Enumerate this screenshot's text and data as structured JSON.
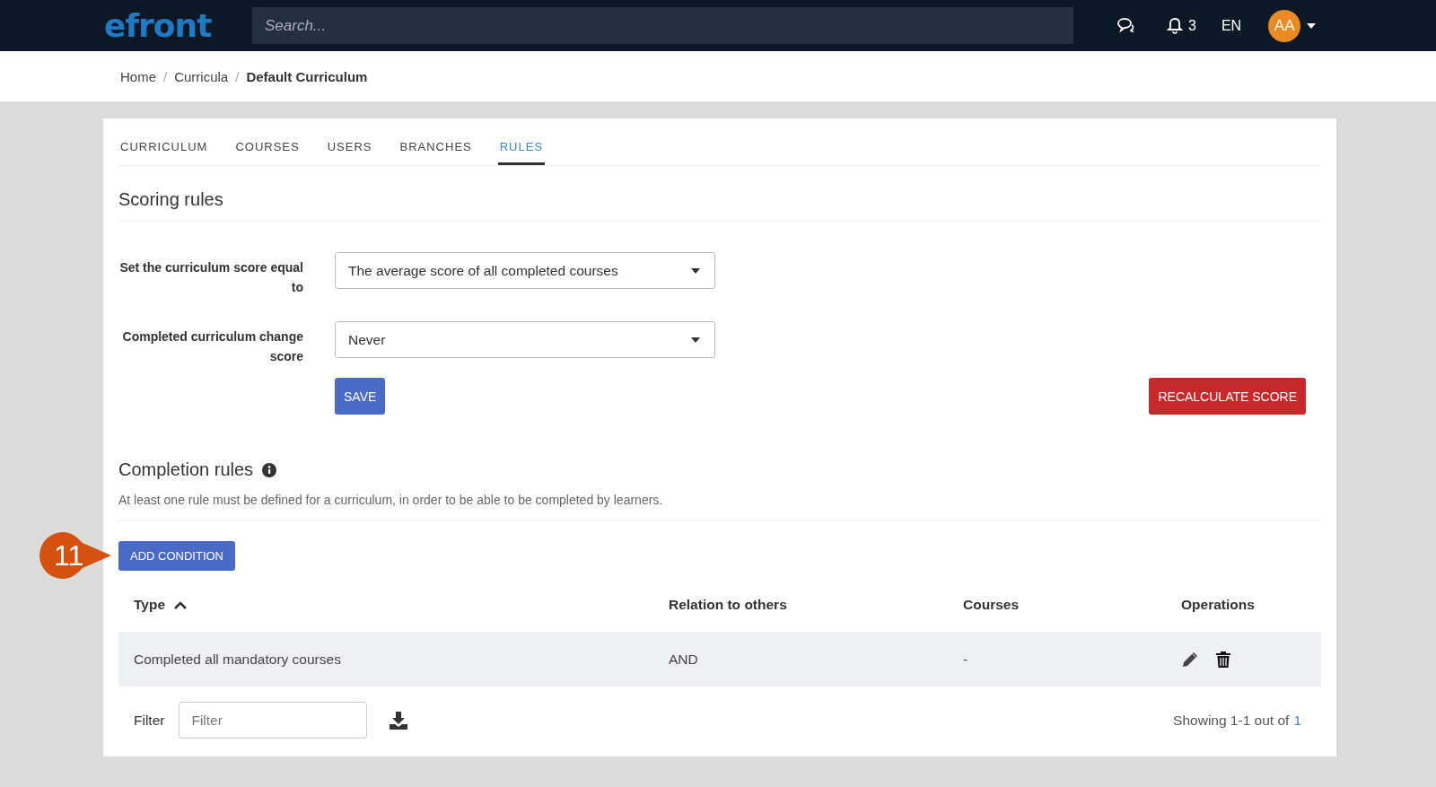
{
  "header": {
    "logo": "efront",
    "search": {
      "placeholder": "Search..."
    },
    "notifications": "3",
    "language": "EN",
    "avatar": "AA"
  },
  "breadcrumb": [
    {
      "label": "Home",
      "current": false
    },
    {
      "label": "Curricula",
      "current": false,
      "separator": "/"
    },
    {
      "label": "Default Curriculum",
      "current": true,
      "separator": "/"
    }
  ],
  "tabs": [
    {
      "label": "CURRICULUM",
      "selected": false
    },
    {
      "label": "COURSES",
      "selected": false
    },
    {
      "label": "USERS",
      "selected": false
    },
    {
      "label": "BRANCHES",
      "selected": false
    },
    {
      "label": "RULES",
      "selected": true
    }
  ],
  "scoring": {
    "title": "Scoring rules",
    "fields": [
      {
        "label": "Set the curriculum score equal to",
        "value": "The average score of all completed courses"
      },
      {
        "label": "Completed curriculum change score",
        "value": "Never"
      }
    ],
    "save": "SAVE",
    "recalculate": "RECALCULATE SCORE"
  },
  "completion": {
    "title": "Completion rules",
    "description": "At least one rule must be defined for a curriculum, in order to be able to be completed by learners.",
    "add_button": "ADD CONDITION",
    "callout": "11",
    "table": {
      "columns": [
        {
          "label": "Type",
          "sorted": true
        },
        {
          "label": "Relation to others",
          "sorted": false
        },
        {
          "label": "Courses",
          "sorted": false
        },
        {
          "label": "Operations",
          "sorted": false
        }
      ],
      "rows": [
        {
          "type": "Completed all mandatory courses",
          "relation": "AND",
          "courses": "-"
        }
      ]
    },
    "filter": {
      "label": "Filter",
      "placeholder": "Filter"
    },
    "showing": "Showing 1-1 out of",
    "total": "1"
  }
}
